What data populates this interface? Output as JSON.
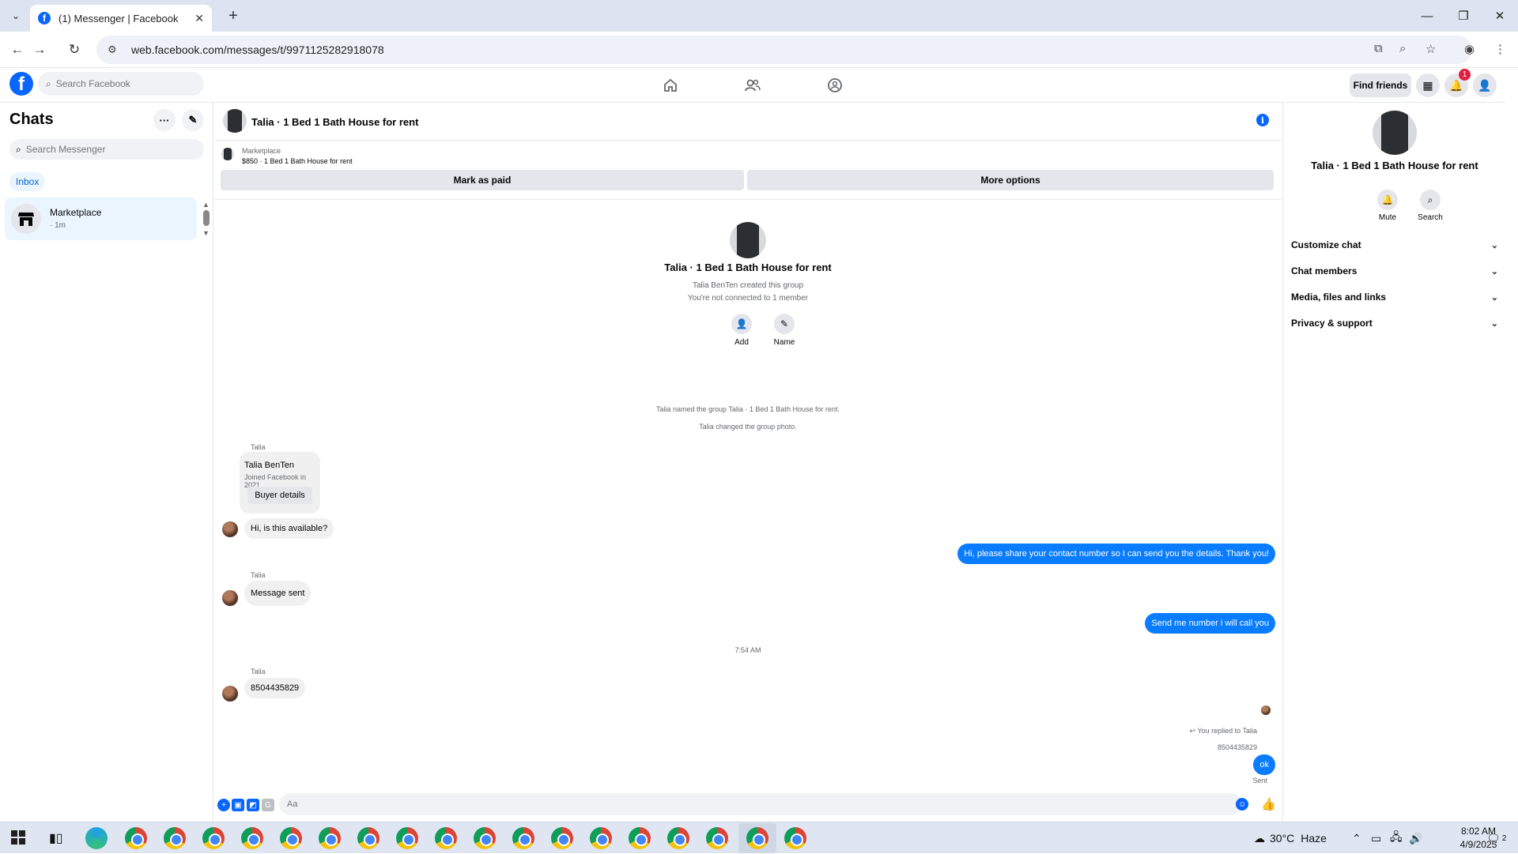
{
  "browser": {
    "tab_title": "(1) Messenger | Facebook",
    "url": "web.facebook.com/messages/t/9971125282918078"
  },
  "fb_header": {
    "search_placeholder": "Search Facebook",
    "find_friends": "Find friends",
    "notification_count": "1"
  },
  "chats": {
    "title": "Chats",
    "search_placeholder": "Search Messenger",
    "filter": "Inbox",
    "items": [
      {
        "name": "Marketplace",
        "time": "· 1m"
      }
    ]
  },
  "conversation": {
    "title": "Talia · 1 Bed 1 Bath House for rent",
    "marketplace": {
      "label": "Marketplace",
      "listing": "$850 · 1 Bed 1 Bath House for rent",
      "mark_paid": "Mark as paid",
      "more_options": "More options"
    },
    "intro": {
      "group_name": "Talia · 1 Bed 1 Bath House for rent",
      "created_by": "Talia BenTen created this group",
      "connection": "You're not connected to 1 member",
      "add_label": "Add",
      "name_label": "Name"
    },
    "events": [
      "Talia named the group Talia · 1 Bed 1 Bath House for rent.",
      "Talia changed the group photo."
    ],
    "profile_card": {
      "sender": "Talia",
      "name": "Talia BenTen",
      "joined": "Joined Facebook in 2021",
      "button": "Buyer details"
    },
    "messages": {
      "m1": "Hi, is this available?",
      "m2": "Hi, please share your contact number so I can send you the details. Thank you!",
      "m3_sender": "Talia",
      "m3": "Message sent",
      "m4": "Send me number i will call you",
      "timestamp": "7:54 AM",
      "m5_sender": "Talia",
      "m5": "8504435829",
      "reply_note": "You replied to Talia",
      "reply_quote": "8504435829",
      "m6": "ok",
      "status": "Sent"
    },
    "composer_placeholder": "Aa"
  },
  "info_panel": {
    "name": "Talia · 1 Bed 1 Bath House for rent",
    "mute": "Mute",
    "search": "Search",
    "sections": [
      "Customize chat",
      "Chat members",
      "Media, files and links",
      "Privacy & support"
    ]
  },
  "taskbar": {
    "temperature": "30°C",
    "weather": "Haze",
    "time": "8:02 AM",
    "date": "4/9/2025",
    "notifications": "2"
  }
}
